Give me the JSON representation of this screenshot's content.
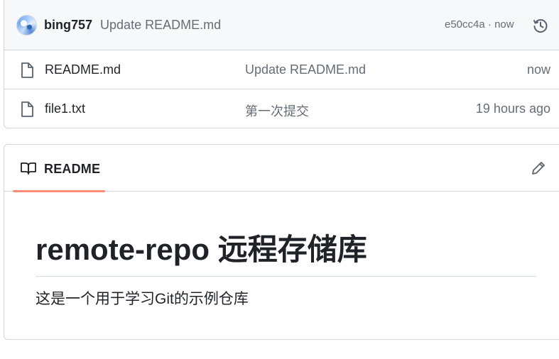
{
  "commit": {
    "author": "bing757",
    "message": "Update README.md",
    "hash": "e50cc4a",
    "separator": "·",
    "time": "now"
  },
  "files": [
    {
      "name": "README.md",
      "message": "Update README.md",
      "time": "now"
    },
    {
      "name": "file1.txt",
      "message": "第一次提交",
      "time": "19 hours ago"
    }
  ],
  "readme": {
    "tab_label": "README",
    "title": "remote-repo 远程存储库",
    "body": "这是一个用于学习Git的示例仓库"
  },
  "colors": {
    "accent_underline": "#fd8c73",
    "muted_text": "#656d76",
    "border": "#d0d7de"
  },
  "icons": {
    "avatar": "avatar",
    "history": "history-icon",
    "file": "file-icon",
    "readme": "book-icon",
    "edit": "pencil-icon"
  }
}
